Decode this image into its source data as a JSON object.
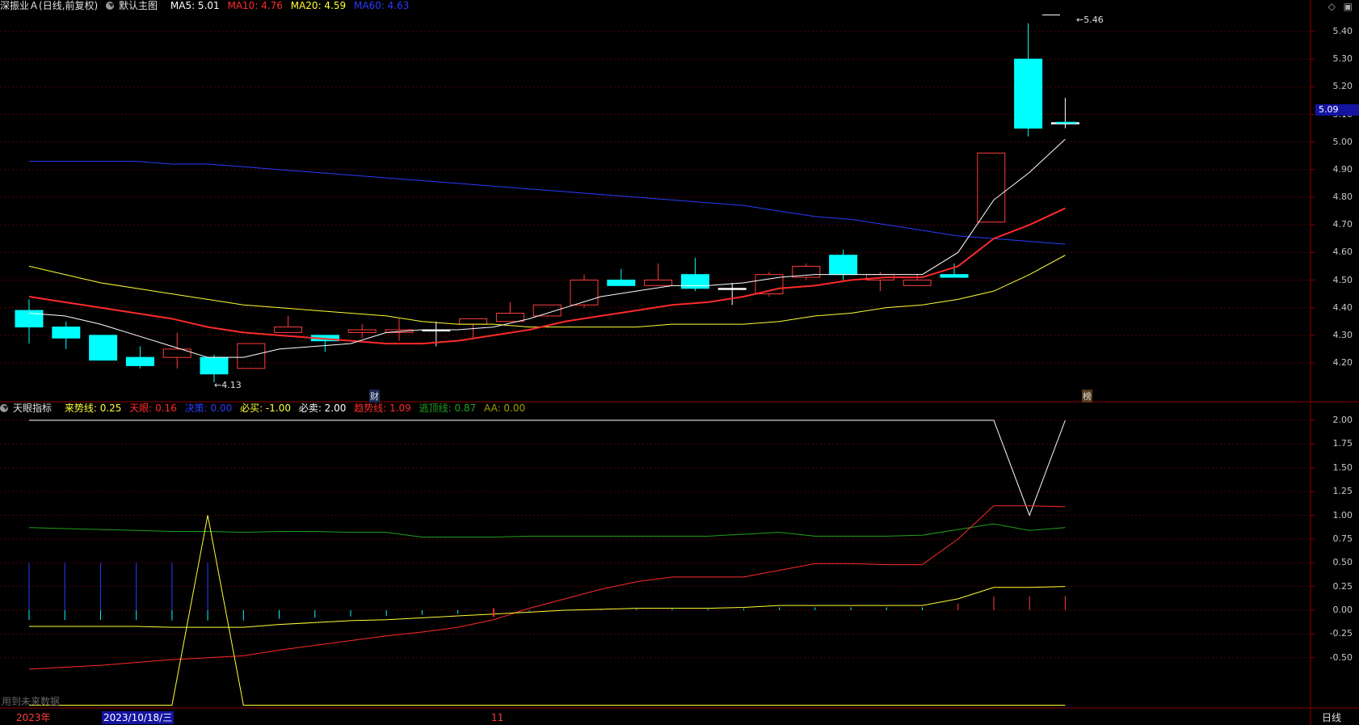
{
  "main_header": {
    "stock": "深振业Ａ",
    "period": "(日线,前复权)",
    "view": "默认主图",
    "indicators": [
      {
        "label": "MA5: 5.01",
        "color": "#ffffff"
      },
      {
        "label": "MA10: 4.76",
        "color": "#ff2a2a"
      },
      {
        "label": "MA20: 4.59",
        "color": "#ffff33"
      },
      {
        "label": "MA60: 4.63",
        "color": "#2a3cff"
      }
    ]
  },
  "sub_header": {
    "name": "天眼指标",
    "indicators": [
      {
        "label": "来势线: 0.25",
        "color": "#ffff33"
      },
      {
        "label": "天眼: 0.16",
        "color": "#ff2a2a"
      },
      {
        "label": "决策: 0.00",
        "color": "#2a3cff"
      },
      {
        "label": "必买: -1.00",
        "color": "#ffff33"
      },
      {
        "label": "必卖: 2.00",
        "color": "#ffffff"
      },
      {
        "label": "趋势线: 1.09",
        "color": "#ff2a2a"
      },
      {
        "label": "逃顶线: 0.87",
        "color": "#1fa01f"
      },
      {
        "label": "AA: 0.00",
        "color": "#a0a000"
      }
    ]
  },
  "main_yaxis": [
    "5.40",
    "5.30",
    "5.20",
    "5.10",
    "5.00",
    "4.90",
    "4.80",
    "4.70",
    "4.60",
    "4.50",
    "4.40",
    "4.30",
    "4.20"
  ],
  "sub_yaxis": [
    "2.00",
    "1.75",
    "1.50",
    "1.25",
    "1.00",
    "0.75",
    "0.50",
    "0.25",
    "0.00",
    "-0.25",
    "-0.50"
  ],
  "price_tag": "5.09",
  "high_label": "5.46",
  "low_label": "4.13",
  "markers": {
    "cai": "财",
    "bang": "榜"
  },
  "footer": {
    "year": "2023年",
    "date": "2023/10/18/三",
    "month": "11",
    "future_note": "用到未来数据",
    "period_btn": "日线"
  },
  "top_right_icons": [
    "diamond-icon",
    "window-icon"
  ],
  "colors": {
    "up": "#ff3c3c",
    "down": "#00ffff",
    "grid": "#8b0000"
  }
}
